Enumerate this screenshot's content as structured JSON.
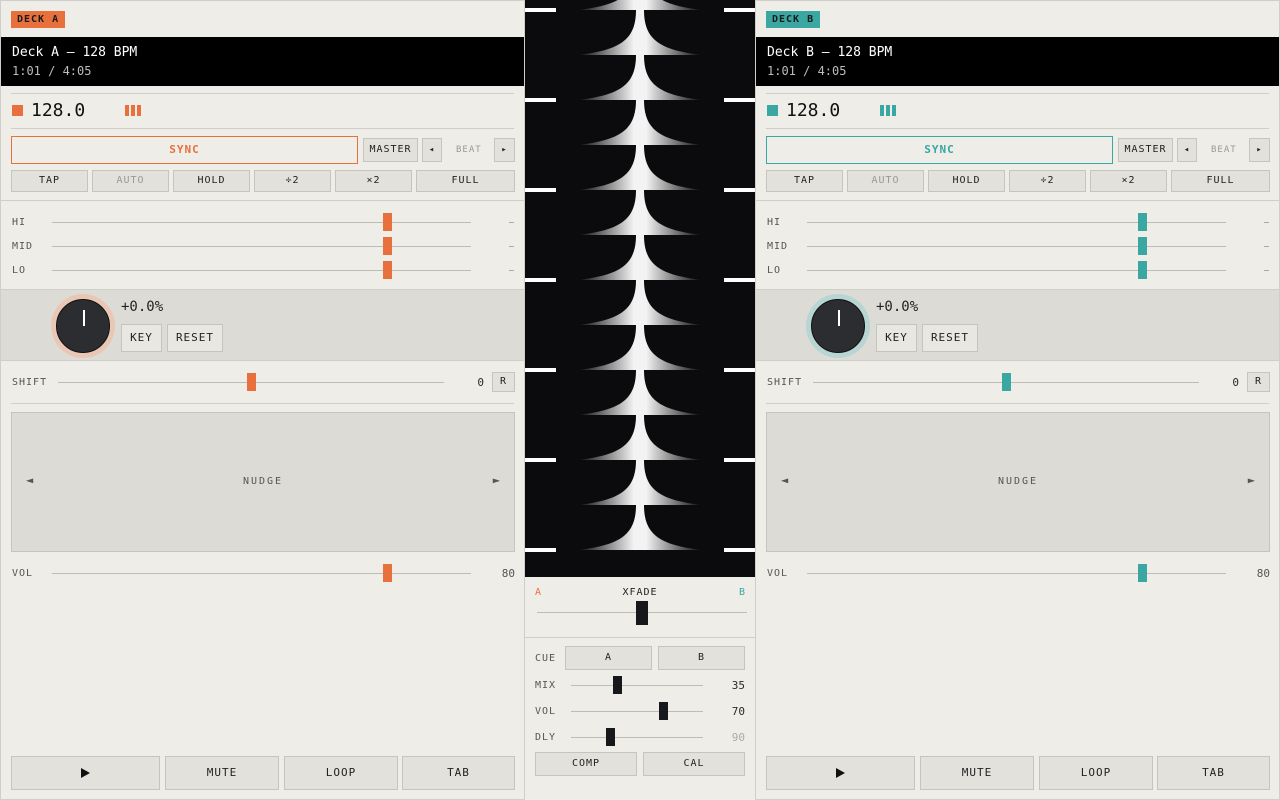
{
  "colors": {
    "deck_a": "#e8703d",
    "deck_b": "#3aa7a3",
    "dark": "#16181b"
  },
  "deck_a": {
    "tag": "DECK A",
    "title": "Deck A — 128 BPM",
    "time": "1:01 / 4:05",
    "bpm": "128.0",
    "sync_label": "SYNC",
    "master_label": "MASTER",
    "beat_prev": "◂",
    "beat_label": "BEAT",
    "beat_next": "▸",
    "buttons": [
      "TAP",
      "AUTO",
      "HOLD",
      "÷2",
      "×2",
      "FULL"
    ],
    "eq": [
      {
        "label": "HI",
        "value": 0.8,
        "end": "—"
      },
      {
        "label": "MID",
        "value": 0.8,
        "end": "—"
      },
      {
        "label": "LO",
        "value": 0.8,
        "end": "—"
      }
    ],
    "key_value": "+0.0%",
    "key_label": "KEY",
    "reset_label": "RESET",
    "shift_label": "SHIFT",
    "shift_value": "0",
    "shift_position": 0.5,
    "shift_reset": "R",
    "nudge_label": "NUDGE",
    "nudge_left": "◄",
    "nudge_right": "►",
    "vol_label": "VOL",
    "vol_value": "80",
    "vol_position": 0.8,
    "transport": [
      "MUTE",
      "LOOP",
      "TAB"
    ]
  },
  "deck_b": {
    "tag": "DECK B",
    "title": "Deck B — 128 BPM",
    "time": "1:01 / 4:05",
    "bpm": "128.0",
    "sync_label": "SYNC",
    "master_label": "MASTER",
    "beat_prev": "◂",
    "beat_label": "BEAT",
    "beat_next": "▸",
    "buttons": [
      "TAP",
      "AUTO",
      "HOLD",
      "÷2",
      "×2",
      "FULL"
    ],
    "eq": [
      {
        "label": "HI",
        "value": 0.8,
        "end": "—"
      },
      {
        "label": "MID",
        "value": 0.8,
        "end": "—"
      },
      {
        "label": "LO",
        "value": 0.8,
        "end": "—"
      }
    ],
    "key_value": "+0.0%",
    "key_label": "KEY",
    "reset_label": "RESET",
    "shift_label": "SHIFT",
    "shift_value": "0",
    "shift_position": 0.5,
    "shift_reset": "R",
    "nudge_label": "NUDGE",
    "nudge_left": "◄",
    "nudge_right": "►",
    "vol_label": "VOL",
    "vol_value": "80",
    "vol_position": 0.8,
    "transport": [
      "MUTE",
      "LOOP",
      "TAB"
    ]
  },
  "mixer": {
    "xfade_a": "A",
    "xfade_label": "XFADE",
    "xfade_b": "B",
    "xfade_position": 0.5,
    "cue_label": "CUE",
    "cue_a": "A",
    "cue_b": "B",
    "rows": [
      {
        "label": "MIX",
        "value": "35",
        "position": 0.35
      },
      {
        "label": "VOL",
        "value": "70",
        "position": 0.7
      },
      {
        "label": "DLY",
        "value": "90",
        "position": 0.3
      }
    ],
    "comp_label": "COMP",
    "cal_label": "CAL"
  }
}
